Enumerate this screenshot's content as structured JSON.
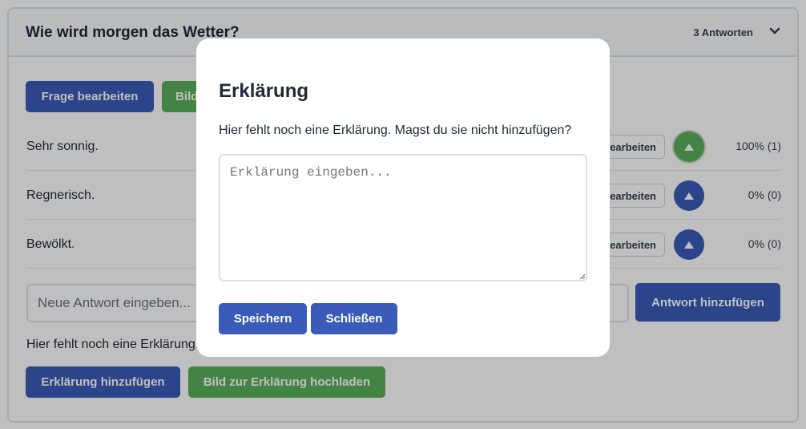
{
  "question": {
    "title": "Wie wird morgen das Wetter?",
    "answers_count": "3 Antworten",
    "buttons": {
      "edit_question": "Frage bearbeiten",
      "image_partial": "Bild"
    },
    "answers": [
      {
        "text": "Sehr sonnig.",
        "edit": "bearbeiten",
        "percent": "100% (1)"
      },
      {
        "text": "Regnerisch.",
        "edit": "bearbeiten",
        "percent": "0% (0)"
      },
      {
        "text": "Bewölkt.",
        "edit": "bearbeiten",
        "percent": "0% (0)"
      }
    ],
    "new_answer_placeholder": "Neue Antwort eingeben...",
    "add_answer_button": "Antwort hinzufügen",
    "explanation_missing": "Hier fehlt noch eine Erklärung.",
    "add_explanation_button": "Erklärung hinzufügen",
    "upload_image_button": "Bild zur Erklärung hochladen"
  },
  "modal": {
    "title": "Erklärung",
    "description": "Hier fehlt noch eine Erklärung. Magst du sie nicht hinzufügen?",
    "textarea_placeholder": "Erklärung eingeben...",
    "save_button": "Speichern",
    "close_button": "Schließen"
  },
  "colors": {
    "primary": "#3a5bb8",
    "success": "#5aaf5a"
  },
  "icons": [
    "chevron-down-icon",
    "upvote-triangle-icon",
    "resize-grip-icon"
  ]
}
